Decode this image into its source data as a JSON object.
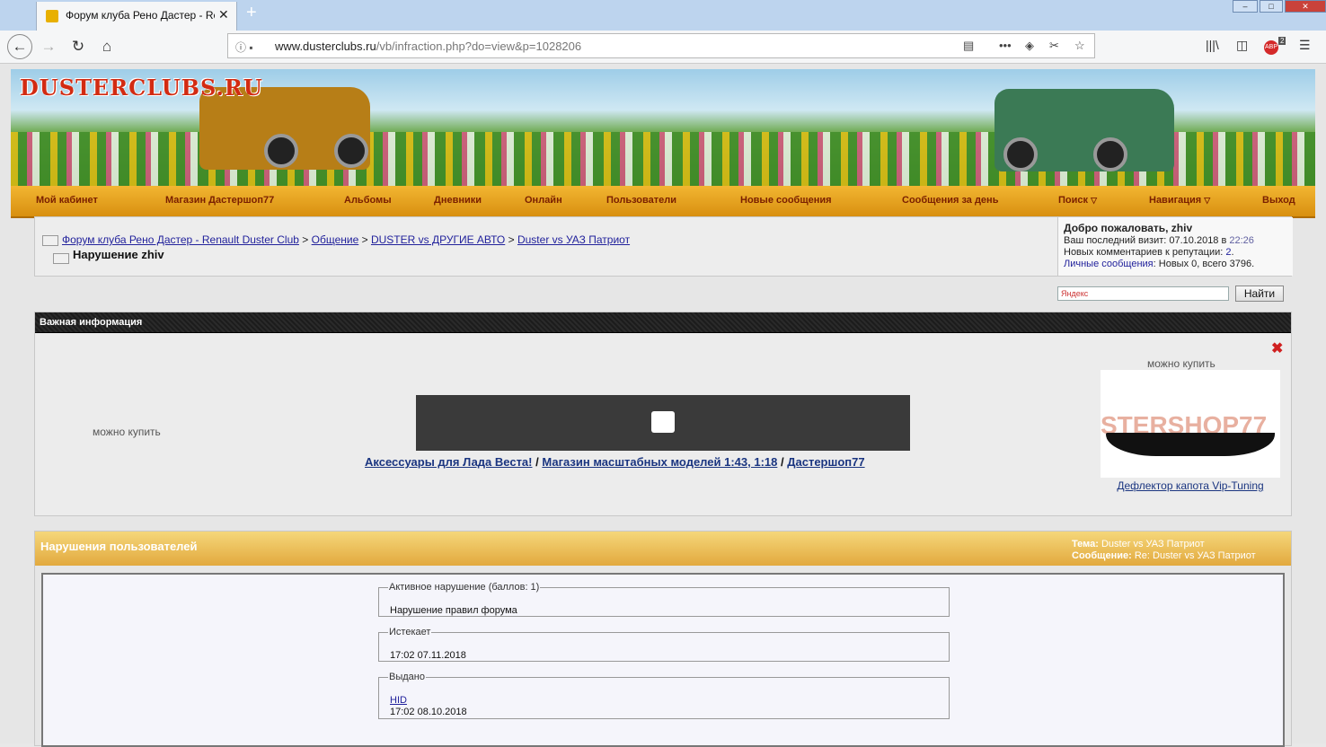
{
  "browser": {
    "tab_title": "Форум клуба Рено Дастер - Renault Duster Club",
    "url_host": "www.dusterclubs.ru",
    "url_path": "/vb/infraction.php?do=view&p=1028206",
    "new_tab": "+",
    "tab_close": "✕",
    "addon_badge": "2"
  },
  "site": {
    "logo": "DUSTERCLUBS.RU",
    "menu": [
      {
        "label": "Мой кабинет"
      },
      {
        "label": "Магазин Дастершоп77"
      },
      {
        "label": "Альбомы"
      },
      {
        "label": "Дневники"
      },
      {
        "label": "Онлайн"
      },
      {
        "label": "Пользователи"
      },
      {
        "label": "Новые сообщения"
      },
      {
        "label": "Сообщения за день"
      },
      {
        "label": "Поиск"
      },
      {
        "label": "Навигация"
      },
      {
        "label": "Выход"
      }
    ]
  },
  "breadcrumb": {
    "items": [
      {
        "label": "Форум клуба Рено Дастер - Renault Duster Club"
      },
      {
        "label": "Общение"
      },
      {
        "label": "DUSTER vs ДРУГИЕ АВТО"
      },
      {
        "label": "Duster vs УАЗ Патриот"
      }
    ],
    "separator": ">",
    "current": "Нарушение zhiv"
  },
  "welcome": {
    "greeting": "Добро пожаловать, zhiv",
    "last_visit_label": "Ваш последний визит: 07.10.2018 в",
    "last_visit_time": "22:26",
    "rep_label": "Новых комментариев к репутации:",
    "rep_count": "2",
    "pm_link": "Личные сообщения",
    "pm_text": ": Новых 0, всего 3796."
  },
  "search": {
    "placeholder": "Яндекс",
    "button": "Найти"
  },
  "info": {
    "title": "Важная информация",
    "close_glyph": "✖",
    "left_label": "можно купить",
    "right_label": "можно купить",
    "links": [
      {
        "label": "Аксессуары для Лада Веста!"
      },
      {
        "label": "Магазин масштабных моделей 1:43, 1:18"
      },
      {
        "label": "Дастершоп77"
      }
    ],
    "link_separator": "/",
    "ad_image_text": "STERSHOP77",
    "ad_caption": "Дефлектор капота Vip-Tuning"
  },
  "violations": {
    "title": "Нарушения пользователей",
    "topic_label": "Тема:",
    "topic_value": "Duster vs УАЗ Патриот",
    "message_label": "Сообщение:",
    "message_value": "Re: Duster vs УАЗ Патриот",
    "active_legend": "Активное нарушение (баллов: 1)",
    "active_text": "Нарушение правил форума",
    "expires_legend": "Истекает",
    "expires_text": "17:02 07.11.2018",
    "issued_legend": "Выдано",
    "issued_by": "HID",
    "issued_text": "17:02 08.10.2018"
  },
  "colors": {
    "menu_bar": "#e8a41e",
    "menu_text": "#7a1f00",
    "link": "#22229c",
    "header_dark": "#222222",
    "violation_header": "#e8b94f"
  }
}
